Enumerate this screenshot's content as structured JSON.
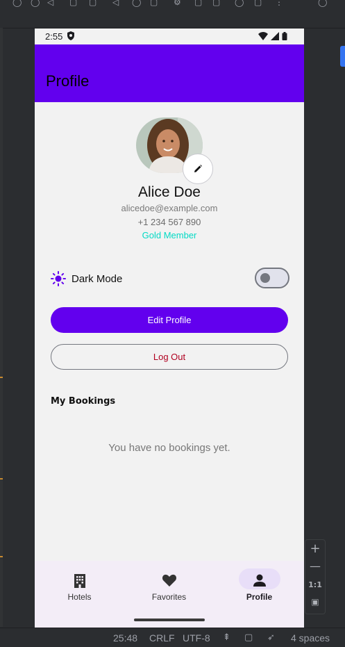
{
  "status_bar": {
    "time": "2:55"
  },
  "app_bar": {
    "title": "Profile"
  },
  "profile": {
    "name": "Alice Doe",
    "email": "alicedoe@example.com",
    "phone": "+1 234 567 890",
    "membership": "Gold Member"
  },
  "settings": {
    "dark_mode_label": "Dark Mode",
    "dark_mode_on": false
  },
  "actions": {
    "edit_profile": "Edit Profile",
    "log_out": "Log Out"
  },
  "bookings": {
    "heading": "My Bookings",
    "empty_text": "You have no bookings yet."
  },
  "bottom_nav": {
    "items": [
      {
        "label": "Hotels",
        "icon": "hotel-icon",
        "active": false
      },
      {
        "label": "Favorites",
        "icon": "heart-icon",
        "active": false
      },
      {
        "label": "Profile",
        "icon": "person-icon",
        "active": true
      }
    ]
  },
  "ide": {
    "zoom_ratio": "1:1",
    "status": {
      "position": "25:48",
      "line_sep": "CRLF",
      "encoding": "UTF-8",
      "indent": "4 spaces"
    }
  },
  "colors": {
    "primary": "#6200ee",
    "secondary": "#03dac5",
    "error": "#b00020",
    "nav_bg": "#f3edf7"
  }
}
